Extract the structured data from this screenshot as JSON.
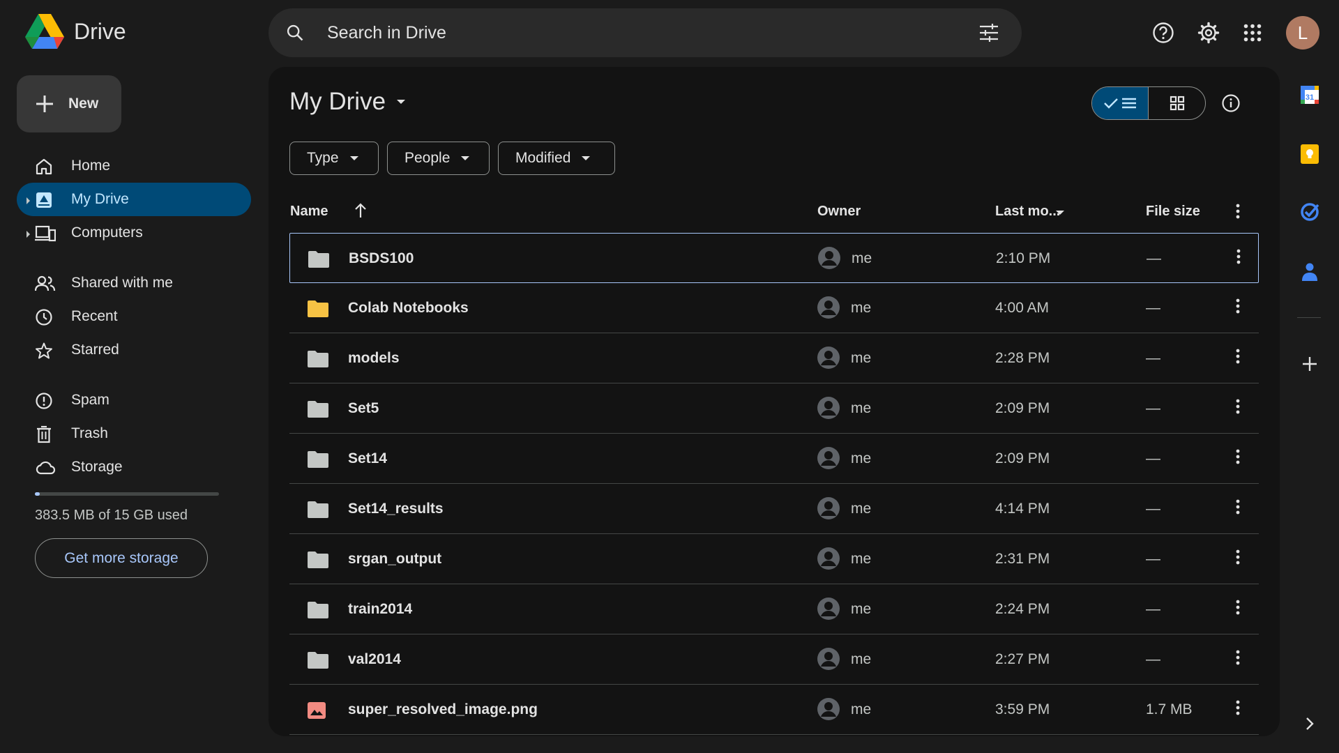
{
  "app": {
    "name": "Drive"
  },
  "search": {
    "placeholder": "Search in Drive"
  },
  "user": {
    "initial": "L"
  },
  "new_button": {
    "label": "New"
  },
  "nav": {
    "items": [
      {
        "label": "Home",
        "icon": "home-icon"
      },
      {
        "label": "My Drive",
        "icon": "my-drive-icon",
        "active": true
      },
      {
        "label": "Computers",
        "icon": "computers-icon"
      },
      {
        "label": "Shared with me",
        "icon": "people-icon"
      },
      {
        "label": "Recent",
        "icon": "clock-icon"
      },
      {
        "label": "Starred",
        "icon": "star-icon"
      },
      {
        "label": "Spam",
        "icon": "spam-icon"
      },
      {
        "label": "Trash",
        "icon": "trash-icon"
      },
      {
        "label": "Storage",
        "icon": "cloud-icon"
      }
    ]
  },
  "storage": {
    "used_text": "383.5 MB of 15 GB used",
    "used_fraction": 0.025,
    "cta": "Get more storage"
  },
  "main": {
    "title": "My Drive",
    "filters": [
      "Type",
      "People",
      "Modified"
    ],
    "columns": {
      "name": "Name",
      "owner": "Owner",
      "modified": "Last mo...",
      "size": "File size"
    },
    "files": [
      {
        "name": "BSDS100",
        "type": "folder",
        "owner": "me",
        "modified": "2:10 PM",
        "size": "—",
        "selected": true
      },
      {
        "name": "Colab Notebooks",
        "type": "folder-yellow",
        "owner": "me",
        "modified": "4:00 AM",
        "size": "—"
      },
      {
        "name": "models",
        "type": "folder",
        "owner": "me",
        "modified": "2:28 PM",
        "size": "—"
      },
      {
        "name": "Set5",
        "type": "folder",
        "owner": "me",
        "modified": "2:09 PM",
        "size": "—"
      },
      {
        "name": "Set14",
        "type": "folder",
        "owner": "me",
        "modified": "2:09 PM",
        "size": "—"
      },
      {
        "name": "Set14_results",
        "type": "folder",
        "owner": "me",
        "modified": "4:14 PM",
        "size": "—"
      },
      {
        "name": "srgan_output",
        "type": "folder",
        "owner": "me",
        "modified": "2:31 PM",
        "size": "—"
      },
      {
        "name": "train2014",
        "type": "folder",
        "owner": "me",
        "modified": "2:24 PM",
        "size": "—"
      },
      {
        "name": "val2014",
        "type": "folder",
        "owner": "me",
        "modified": "2:27 PM",
        "size": "—"
      },
      {
        "name": "super_resolved_image.png",
        "type": "image",
        "owner": "me",
        "modified": "3:59 PM",
        "size": "1.7 MB"
      }
    ]
  },
  "colors": {
    "accent": "#a8c7fa",
    "active_bg": "#004a77",
    "folder": "#c4c7c5",
    "folder_yellow": "#f6c244",
    "image": "#f28b82"
  }
}
